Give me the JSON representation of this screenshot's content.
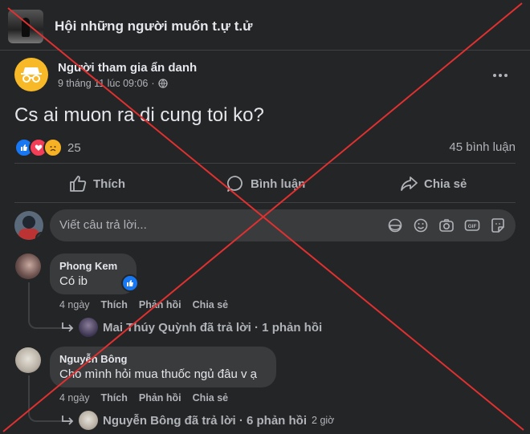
{
  "group": {
    "name": "Hội những người muốn t.ự t.ử"
  },
  "post": {
    "author": "Người tham gia ẩn danh",
    "date": "9 tháng 11 lúc 09:06",
    "dot": "·",
    "text": "Cs ai muon ra di cung toi ko?",
    "reaction_count": "25",
    "comment_count": "45 bình luận"
  },
  "actions": {
    "like": "Thích",
    "comment": "Bình luận",
    "share": "Chia sẻ"
  },
  "reply_box": {
    "placeholder": "Viết câu trả lời..."
  },
  "comments": [
    {
      "name": "Phong Kem",
      "text": "Có ib",
      "time": "4 ngày",
      "like": "Thích",
      "reply": "Phản hồi",
      "share": "Chia sẻ",
      "replies_summary": "Mai Thúy Quỳnh đã trả lời · 1 phản hồi"
    },
    {
      "name": "Nguyễn Bông",
      "text": "Cho mình hỏi mua thuốc ngủ đâu v ạ",
      "time": "4 ngày",
      "like": "Thích",
      "reply": "Phản hồi",
      "share": "Chia sẻ",
      "replies_summary": "Nguyễn Bông đã trả lời · 6 phản hồi",
      "replies_time": "2 giờ"
    }
  ],
  "colors": {
    "background": "#242526",
    "overlay_x": "#e03030",
    "like_blue": "#1877f2"
  }
}
